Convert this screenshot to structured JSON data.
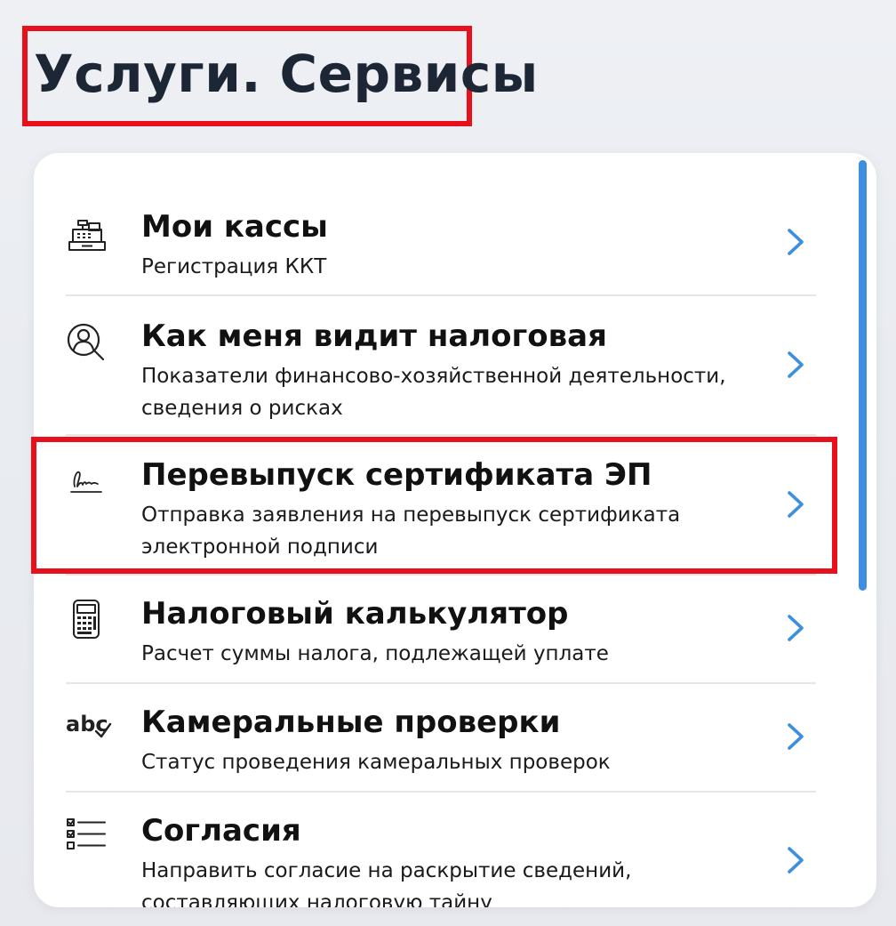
{
  "page": {
    "title": "Услуги. Сервисы"
  },
  "services": [
    {
      "title": "Мои кассы",
      "subtitle": "Регистрация ККТ",
      "icon": "cash-register-icon"
    },
    {
      "title": "Как меня видит налоговая",
      "subtitle": "Показатели финансово-хозяйственной деятельности, сведения о рисках",
      "icon": "user-search-icon"
    },
    {
      "title": "Перевыпуск сертификата ЭП",
      "subtitle": "Отправка заявления на перевыпуск сертификата электронной подписи",
      "icon": "signature-icon"
    },
    {
      "title": "Налоговый калькулятор",
      "subtitle": "Расчет суммы налога, подлежащей уплате",
      "icon": "calculator-icon"
    },
    {
      "title": "Камеральные проверки",
      "subtitle": "Статус проведения камеральных проверок",
      "icon": "abc-check-icon",
      "icon_text": "abc"
    },
    {
      "title": "Согласия",
      "subtitle": "Направить согласие на раскрытие сведений, составляющих налоговую тайну",
      "icon": "checklist-icon"
    }
  ],
  "colors": {
    "highlight": "#e8101b",
    "accent": "#3f8fe0",
    "title": "#1d2634"
  }
}
